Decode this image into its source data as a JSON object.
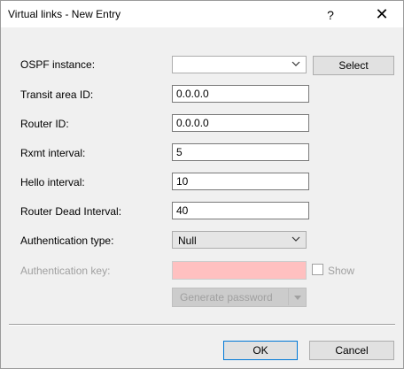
{
  "title": "Virtual links - New Entry",
  "titlebar": {
    "help": "?",
    "close": "✕"
  },
  "fields": {
    "ospf_instance": {
      "label": "OSPF instance:",
      "value": "",
      "select_label": "Select"
    },
    "transit_area_id": {
      "label": "Transit area ID:",
      "value": "0.0.0.0"
    },
    "router_id": {
      "label": "Router ID:",
      "value": "0.0.0.0"
    },
    "rxmt_interval": {
      "label": "Rxmt interval:",
      "value": "5"
    },
    "hello_interval": {
      "label": "Hello interval:",
      "value": "10"
    },
    "router_dead_interval": {
      "label": "Router Dead Interval:",
      "value": "40"
    },
    "authentication_type": {
      "label": "Authentication type:",
      "value": "Null"
    },
    "authentication_key": {
      "label": "Authentication key:",
      "value": "",
      "show_label": "Show"
    }
  },
  "generate_password": {
    "label": "Generate password"
  },
  "buttons": {
    "ok": "OK",
    "cancel": "Cancel"
  },
  "icons": {
    "dropdown": "chevron-down-icon"
  }
}
